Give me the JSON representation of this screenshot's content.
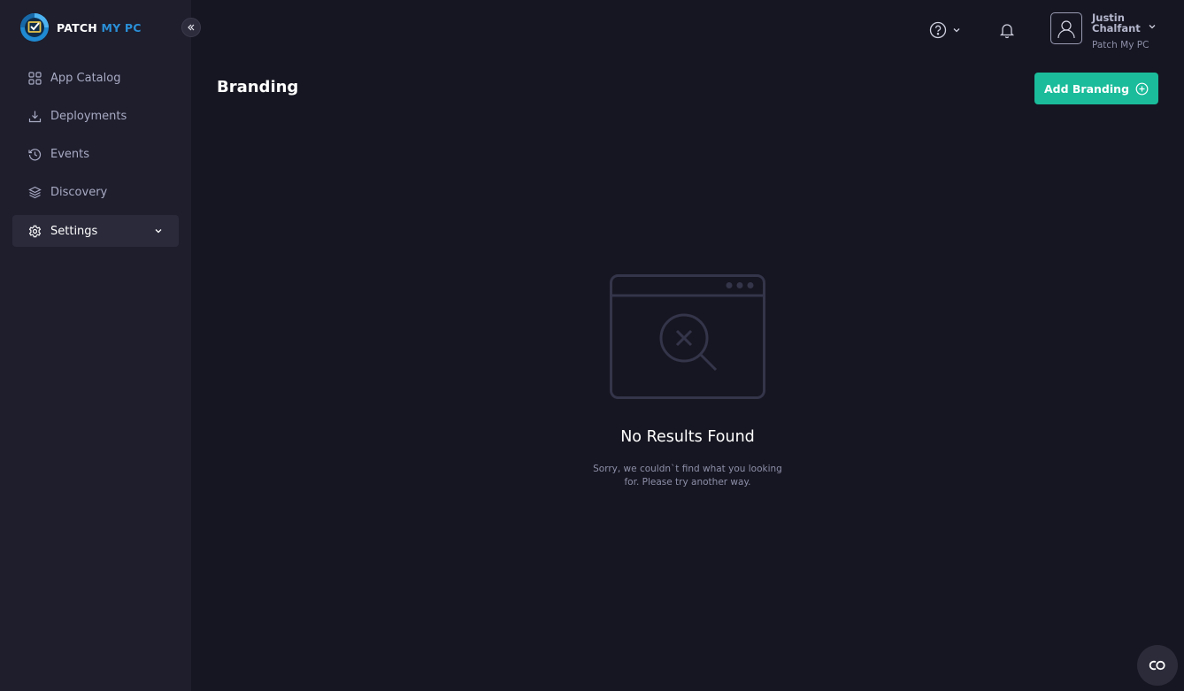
{
  "brand": {
    "name_part1": "PATCH",
    "name_part2": "MY PC",
    "accent_color": "#2a8fd6"
  },
  "sidebar": {
    "items": [
      {
        "label": "App Catalog",
        "icon": "grid-icon"
      },
      {
        "label": "Deployments",
        "icon": "download-icon"
      },
      {
        "label": "Events",
        "icon": "history-icon"
      },
      {
        "label": "Discovery",
        "icon": "layers-icon"
      },
      {
        "label": "Settings",
        "icon": "gear-icon",
        "active": true,
        "expandable": true
      }
    ]
  },
  "user": {
    "name": "Justin Chalfant",
    "org": "Patch My PC"
  },
  "page": {
    "title": "Branding",
    "add_button_label": "Add Branding",
    "button_color": "#1bbc9b"
  },
  "empty_state": {
    "title": "No Results Found",
    "description": "Sorry, we couldn`t find what you looking for. Please try another way."
  }
}
